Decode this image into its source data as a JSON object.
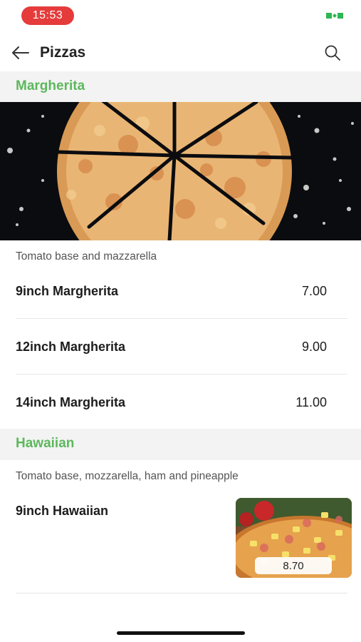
{
  "status_bar": {
    "time": "15:53",
    "battery_icon": "battery-charging-icon",
    "accent_color": "#e53b3b"
  },
  "nav": {
    "title": "Pizzas",
    "back_icon": "arrow-left-icon",
    "search_icon": "search-icon"
  },
  "brand_color": "#5cb85c",
  "sections": [
    {
      "title": "Margherita",
      "description": "Tomato base and mazzarella",
      "items": [
        {
          "name": "9inch Margherita",
          "price": "7.00"
        },
        {
          "name": "12inch Margherita",
          "price": "9.00"
        },
        {
          "name": "14inch Margherita",
          "price": "11.00"
        }
      ]
    },
    {
      "title": "Hawaiian",
      "description": "Tomato base, mozzarella, ham and pineapple",
      "items": [
        {
          "name": "9inch Hawaiian",
          "price": "8.70"
        }
      ]
    }
  ]
}
